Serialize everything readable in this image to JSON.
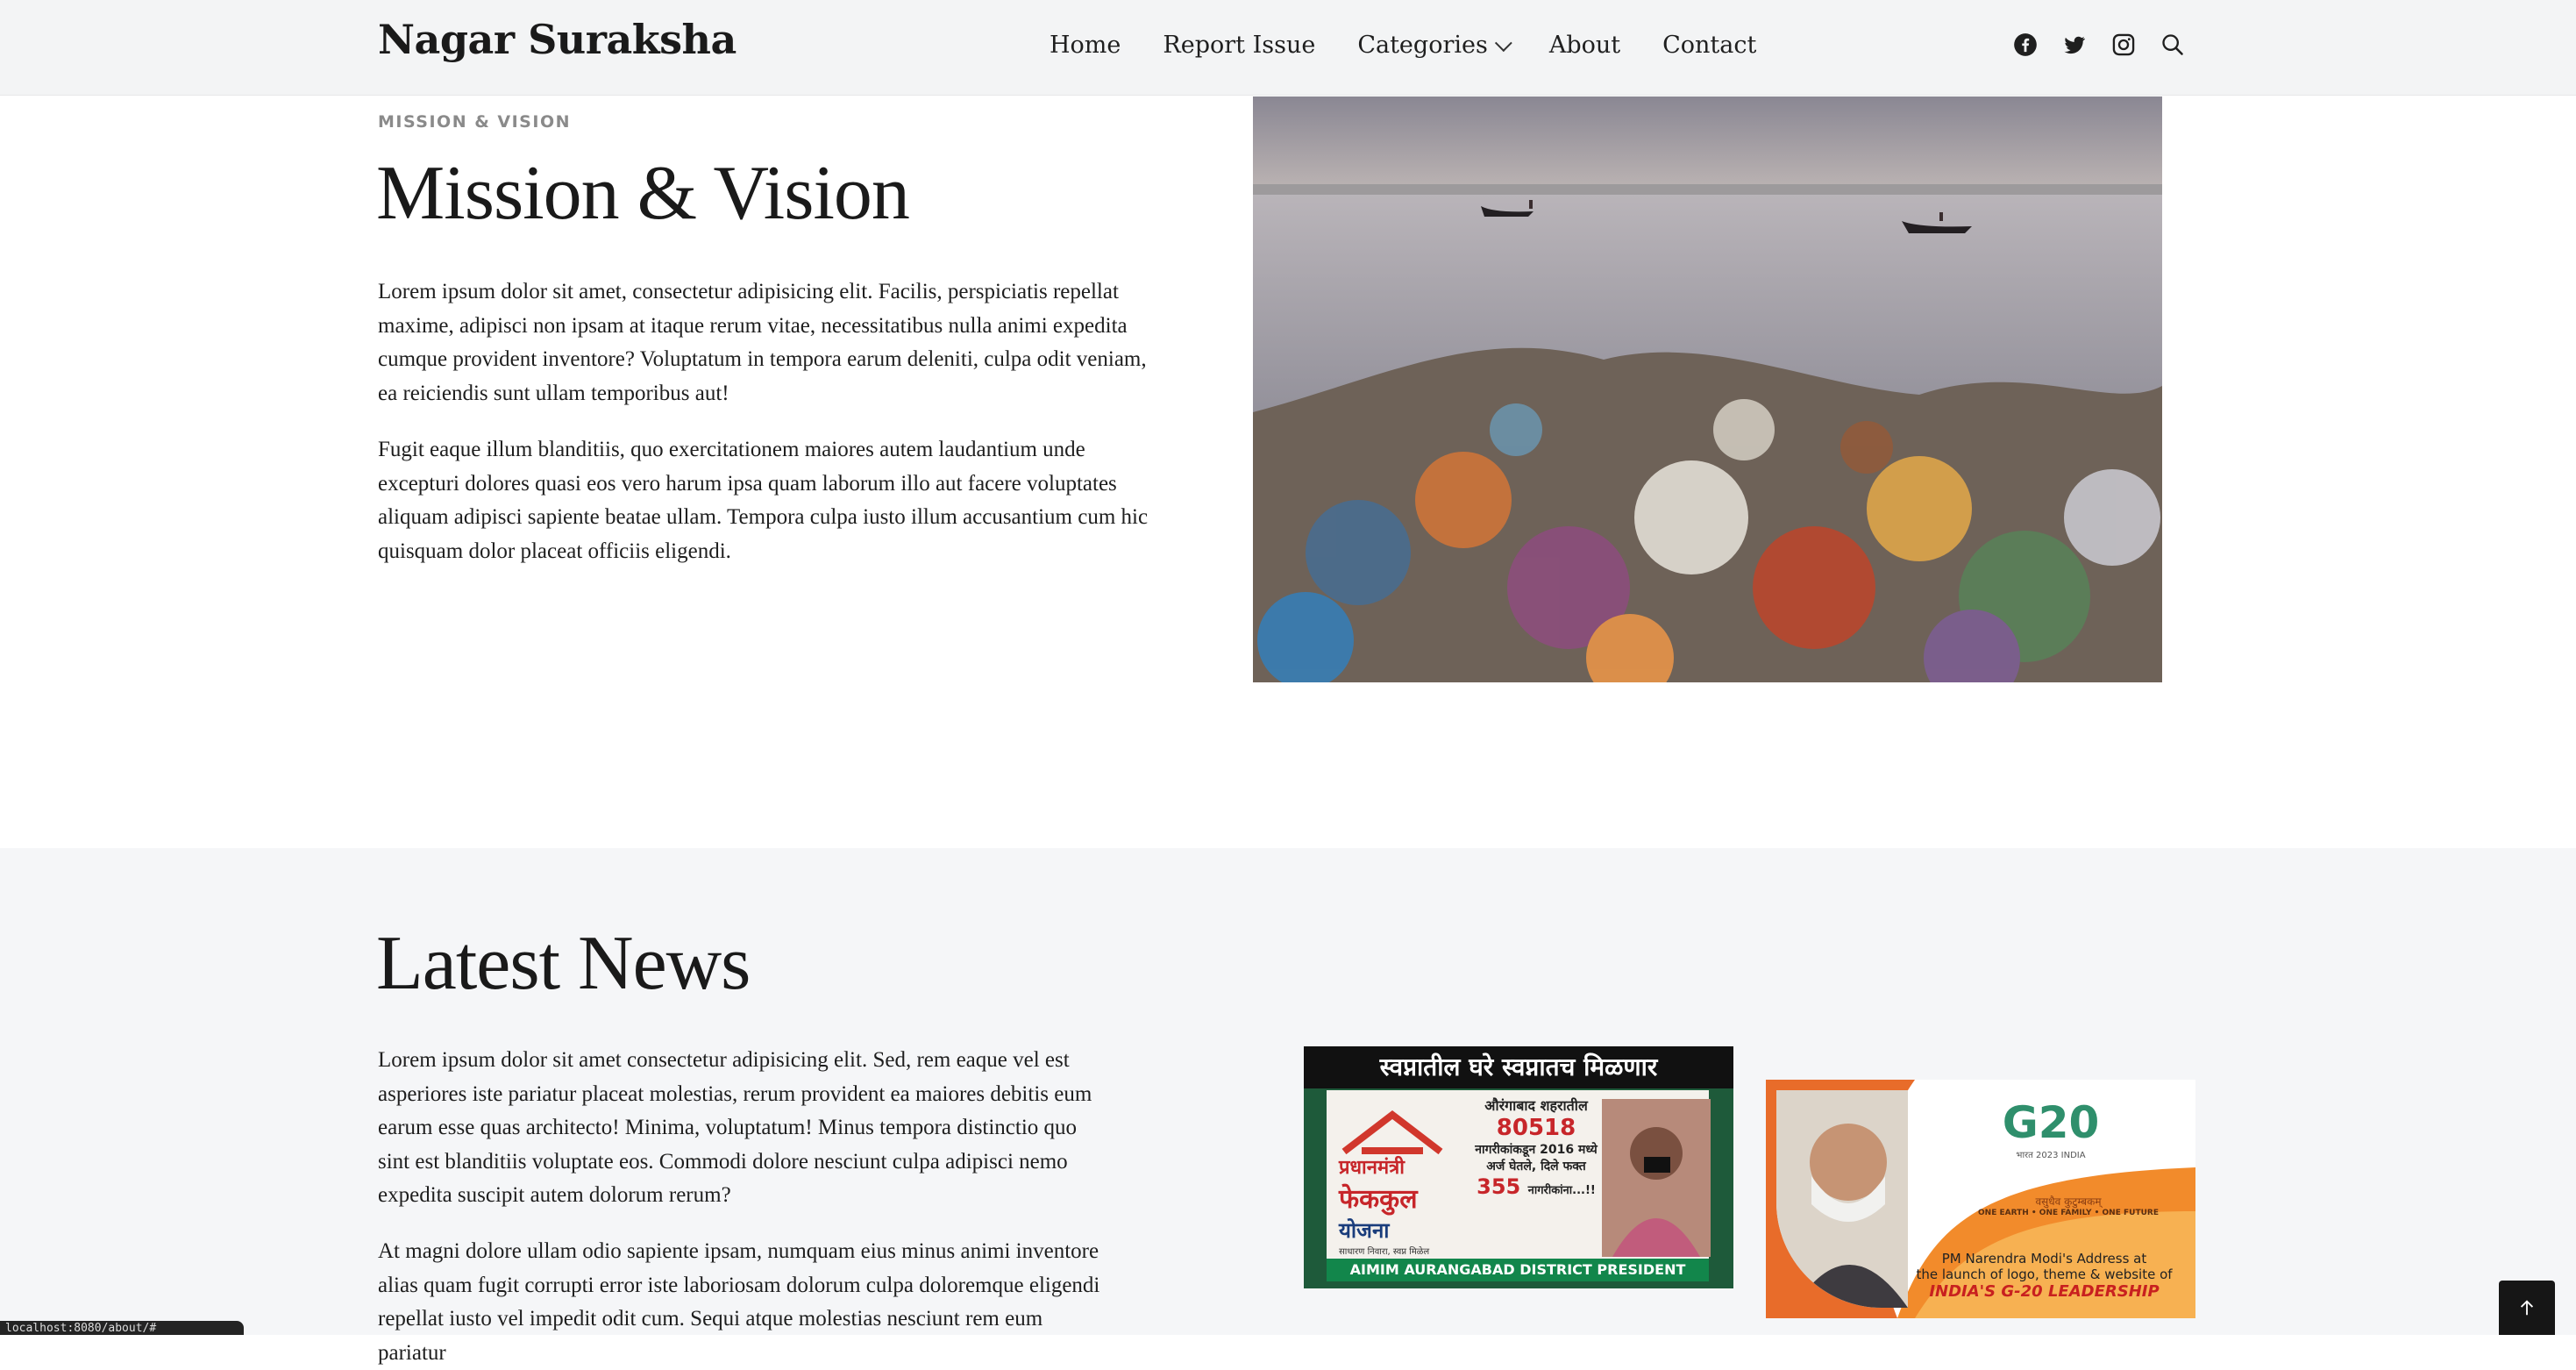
{
  "header": {
    "brand": "Nagar Suraksha",
    "nav": [
      "Home",
      "Report Issue",
      "Categories",
      "About",
      "Contact"
    ],
    "icons": [
      "facebook-icon",
      "twitter-icon",
      "instagram-icon",
      "search-icon"
    ]
  },
  "mission": {
    "eyebrow": "MISSION & VISION",
    "title": "Mission & Vision",
    "paragraphs": [
      "Lorem ipsum dolor sit amet, consectetur adipisicing elit. Facilis, perspiciatis repellat maxime, adipisci non ipsam at itaque rerum vitae, necessitatibus nulla animi expedita cumque provident inventore? Voluptatum in tempora earum deleniti, culpa odit veniam, ea reiciendis sunt ullam temporibus aut!",
      "Fugit eaque illum blanditiis, quo exercitationem maiores autem laudantium unde excepturi dolores quasi eos vero harum ipsa quam laborum illo aut facere voluptates aliquam adipisci sapiente beatae ullam. Tempora culpa iusto illum accusantium cum hic quisquam dolor placeat officiis eligendi."
    ]
  },
  "news": {
    "title": "Latest News",
    "paragraphs": [
      "Lorem ipsum dolor sit amet consectetur adipisicing elit. Sed, rem eaque vel est asperiores iste pariatur placeat molestias, rerum provident ea maiores debitis eum earum esse quas architecto! Minima, voluptatum! Minus tempora distinctio quo sint est blanditiis voluptate eos. Commodi dolore nesciunt culpa adipisci nemo expedita suscipit autem dolorum rerum?",
      "At magni dolore ullam odio sapiente ipsam, numquam eius minus animi inventore alias quam fugit corrupti error iste laboriosam dolorum culpa doloremque eligendi repellat iusto vel impedit odit cum. Sequi atque molestias nesciunt rem eum pariatur"
    ],
    "card1": {
      "headline": "स्वप्नातील घरे स्वप्नातच मिळणार",
      "logo_line1": "प्रधानमंत्री",
      "logo_line2": "फेककुल",
      "logo_line3": "योजना",
      "city_line": "औरंगाबाद शहरातील",
      "number": "80518",
      "line_a": "नागरीकांकडून 2016 मध्ये",
      "line_b": "अर्ज घेतले, दिले फक्त",
      "count": "355",
      "count_suffix": "नागरीकांना...!!",
      "subline": "साधारण निवारा, स्वप्न मिळेल",
      "footer": "AIMIM AURANGABAD DISTRICT PRESIDENT"
    },
    "card2": {
      "logo": "G20",
      "logo_sub": "भारत 2023 INDIA",
      "hindi": "वसुधैव कुटुम्बकम्",
      "motto": "ONE EARTH • ONE FAMILY • ONE FUTURE",
      "caption1": "PM Narendra Modi's Address at",
      "caption2": "the launch of logo, theme & website of",
      "caption3": "INDIA'S G-20 LEADERSHIP"
    }
  },
  "status_bar": "localhost:8080/about/#"
}
